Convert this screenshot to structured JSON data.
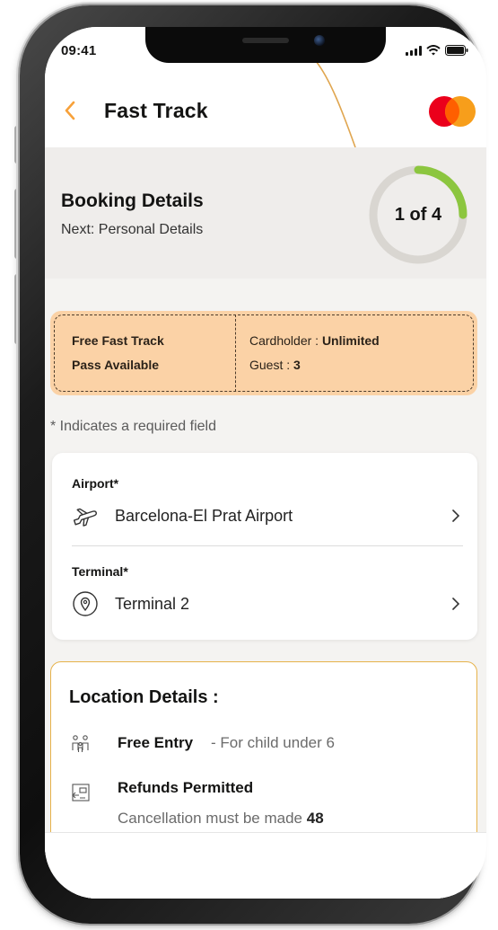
{
  "status_bar": {
    "time": "09:41",
    "icons": [
      "signal-icon",
      "wifi-icon",
      "battery-icon"
    ]
  },
  "header": {
    "back_icon": "chevron-left-icon",
    "title": "Fast Track",
    "logo": "mastercard-logo"
  },
  "booking": {
    "title": "Booking Details",
    "next": "Next: Personal Details",
    "progress_label": "1 of 4",
    "step": 1,
    "total_steps": 4
  },
  "pass_banner": {
    "left_line1": "Free Fast Track",
    "left_line2": "Pass Available",
    "cardholder_label": "Cardholder : ",
    "cardholder_value": "Unlimited",
    "guest_label": "Guest : ",
    "guest_value": "3"
  },
  "required_note": "* Indicates a required field",
  "form": {
    "airport_label": "Airport*",
    "airport_value": "Barcelona-El Prat Airport",
    "terminal_label": "Terminal*",
    "terminal_value": "Terminal 2"
  },
  "location": {
    "title": "Location Details :",
    "free_entry_label": "Free Entry",
    "free_entry_desc": "- For child under 6",
    "refunds_label": "Refunds Permitted",
    "refunds_desc": "Cancellation must be made",
    "refunds_hours": "48"
  },
  "colors": {
    "accent_orange": "#f7a13a",
    "accent_green": "#8cc63f",
    "banner_bg": "#fbd2a6",
    "gold_border": "#e6b24a",
    "mastercard_red": "#eb001b",
    "mastercard_orange": "#f79e1b"
  }
}
